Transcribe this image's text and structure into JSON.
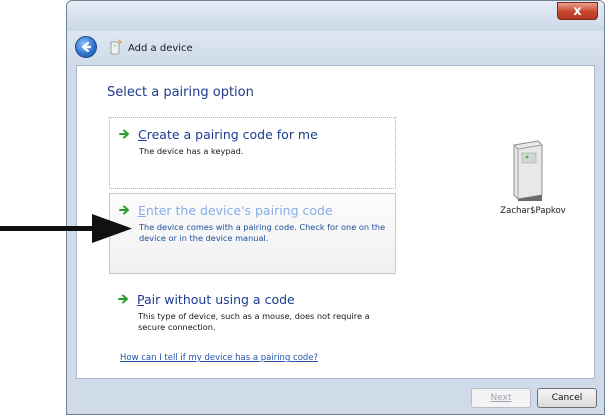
{
  "window": {
    "close_glyph": "x"
  },
  "nav": {
    "title": "Add a device",
    "back_icon": "back-arrow-icon",
    "device_icon": "bluetooth-device-icon"
  },
  "content": {
    "heading": "Select a pairing option",
    "options": [
      {
        "title": "Create a pairing code for me",
        "accel": "C",
        "desc": "The device has a keypad."
      },
      {
        "title": "Enter the device's pairing code",
        "accel": "E",
        "desc": "The device comes with a pairing code. Check for one on the device or in the device manual."
      },
      {
        "title": "Pair without using a code",
        "accel": "P",
        "desc": "This type of device, such as a mouse, does not require a secure connection."
      }
    ],
    "help_link": "How can I tell if my device has a pairing code?",
    "device_name": "Zachar$Papkov"
  },
  "footer": {
    "next_label": "Next",
    "cancel_label": "Cancel"
  },
  "colors": {
    "accent": "#1a3d8f",
    "arrow_green": "#2f9e2c",
    "link": "#2553a9",
    "close_red": "#c8462d"
  }
}
